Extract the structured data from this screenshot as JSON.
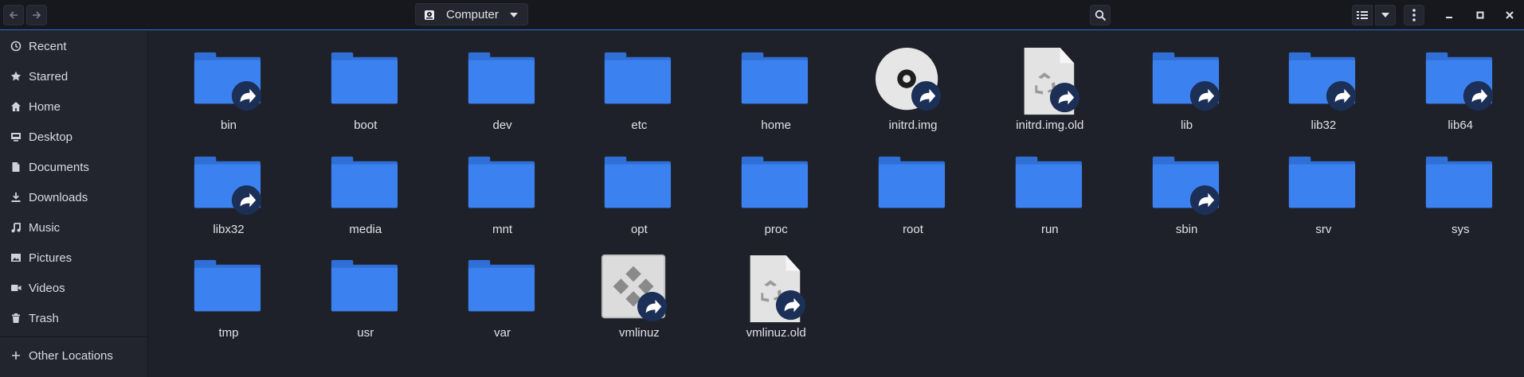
{
  "header": {
    "location_label": "Computer",
    "icons": {
      "back": "arrow-left-icon",
      "forward": "arrow-right-icon",
      "search": "search-icon",
      "view": "list-view-icon",
      "view_dropdown": "chevron-down-icon",
      "menu": "kebab-menu-icon",
      "minimize": "minimize-icon",
      "maximize": "maximize-icon",
      "close": "close-icon"
    }
  },
  "sidebar": {
    "items": [
      {
        "label": "Recent",
        "icon": "clock-icon"
      },
      {
        "label": "Starred",
        "icon": "star-icon"
      },
      {
        "label": "Home",
        "icon": "home-icon"
      },
      {
        "label": "Desktop",
        "icon": "desktop-icon"
      },
      {
        "label": "Documents",
        "icon": "document-icon"
      },
      {
        "label": "Downloads",
        "icon": "download-icon"
      },
      {
        "label": "Music",
        "icon": "music-icon"
      },
      {
        "label": "Pictures",
        "icon": "picture-icon"
      },
      {
        "label": "Videos",
        "icon": "video-icon"
      },
      {
        "label": "Trash",
        "icon": "trash-icon"
      }
    ],
    "other_locations": {
      "label": "Other Locations",
      "icon": "plus-icon"
    }
  },
  "files": [
    {
      "name": "bin",
      "kind": "folder",
      "link": true
    },
    {
      "name": "boot",
      "kind": "folder",
      "link": false
    },
    {
      "name": "dev",
      "kind": "folder",
      "link": false
    },
    {
      "name": "etc",
      "kind": "folder",
      "link": false
    },
    {
      "name": "home",
      "kind": "folder",
      "link": false
    },
    {
      "name": "initrd.img",
      "kind": "disc",
      "link": true
    },
    {
      "name": "initrd.img.old",
      "kind": "file",
      "link": true
    },
    {
      "name": "lib",
      "kind": "folder",
      "link": true
    },
    {
      "name": "lib32",
      "kind": "folder",
      "link": true
    },
    {
      "name": "lib64",
      "kind": "folder",
      "link": true
    },
    {
      "name": "libx32",
      "kind": "folder",
      "link": true
    },
    {
      "name": "media",
      "kind": "folder",
      "link": false
    },
    {
      "name": "mnt",
      "kind": "folder",
      "link": false
    },
    {
      "name": "opt",
      "kind": "folder",
      "link": false
    },
    {
      "name": "proc",
      "kind": "folder",
      "link": false
    },
    {
      "name": "root",
      "kind": "folder",
      "link": false
    },
    {
      "name": "run",
      "kind": "folder",
      "link": false
    },
    {
      "name": "sbin",
      "kind": "folder",
      "link": true
    },
    {
      "name": "srv",
      "kind": "folder",
      "link": false
    },
    {
      "name": "sys",
      "kind": "folder",
      "link": false
    },
    {
      "name": "tmp",
      "kind": "folder",
      "link": false
    },
    {
      "name": "usr",
      "kind": "folder",
      "link": false
    },
    {
      "name": "var",
      "kind": "folder",
      "link": false
    },
    {
      "name": "vmlinuz",
      "kind": "executable",
      "link": true
    },
    {
      "name": "vmlinuz.old",
      "kind": "file",
      "link": true
    }
  ],
  "colors": {
    "folder": "#3b82f0",
    "folder_tab": "#2f6fd6",
    "accent": "#2f6fd6",
    "link_badge": "#1b2f57"
  }
}
